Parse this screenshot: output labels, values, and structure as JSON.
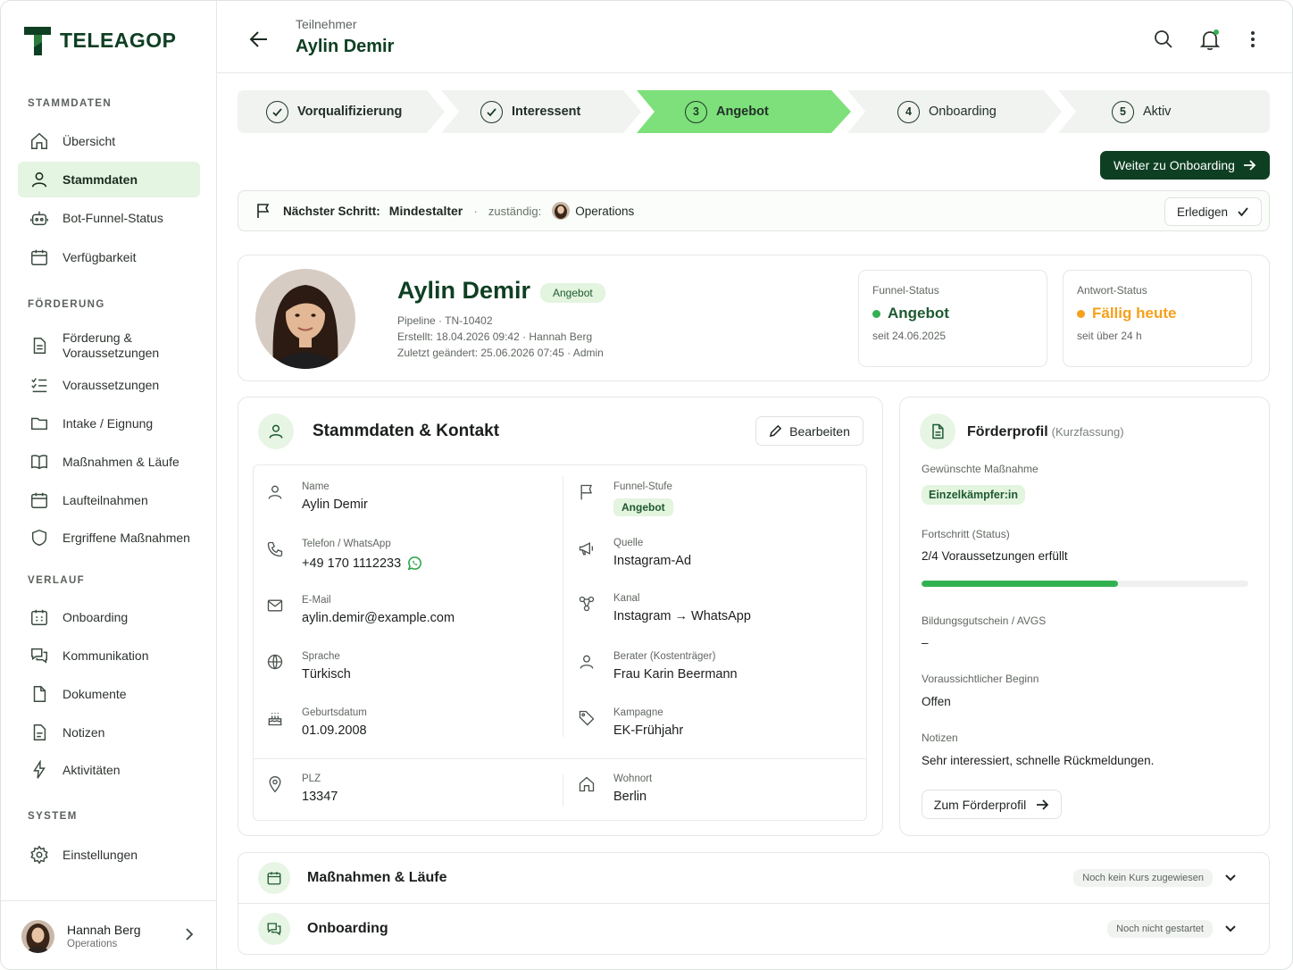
{
  "brand": {
    "name": "TELEAGOP"
  },
  "sidebar": {
    "sections": {
      "stammdaten": "STAMMDATEN",
      "foerderung": "FÖRDERUNG",
      "verlauf": "VERLAUF",
      "system": "SYSTEM"
    },
    "items": {
      "uebersicht": "Übersicht",
      "stammdaten": "Stammdaten",
      "bot_funnel_status": "Bot-Funnel-Status",
      "verfuegbarkeit": "Verfügbarkeit",
      "foerderung_line1": "Förderung &",
      "foerderung_line2": "Voraussetzungen",
      "voraussetzungen": "Voraussetzungen",
      "intake": "Intake / Eignung",
      "massnahmen": "Maßnahmen & Läufe",
      "laufteilnahmen": "Laufteilnahmen",
      "ergriffene": "Ergriffene Maßnahmen",
      "onboarding": "Onboarding",
      "kommunikation": "Kommunikation",
      "dokumente": "Dokumente",
      "notizen": "Notizen",
      "aktivitaeten": "Aktivitäten",
      "einstellungen": "Einstellungen"
    },
    "user": {
      "name": "Hannah Berg",
      "role": "Operations"
    }
  },
  "header": {
    "breadcrumb": "Teilnehmer",
    "title": "Aylin Demir"
  },
  "stepper": {
    "steps": [
      {
        "label": "Vorqualifizierung",
        "marker": "check",
        "state": "done"
      },
      {
        "label": "Interessent",
        "marker": "check",
        "state": "done"
      },
      {
        "label": "Angebot",
        "marker": "3",
        "state": "active"
      },
      {
        "label": "Onboarding",
        "marker": "4",
        "state": "upcoming"
      },
      {
        "label": "Aktiv",
        "marker": "5",
        "state": "upcoming"
      }
    ]
  },
  "actions": {
    "next_button": "Weiter zu Onboarding"
  },
  "next_step": {
    "label": "Nächster Schritt:",
    "value": "Mindestalter",
    "separator": "·",
    "owner_label": "zuständig:",
    "owner": "Operations",
    "done_button": "Erledigen"
  },
  "profile": {
    "name": "Aylin Demir",
    "badge": "Angebot",
    "meta_line1": "Pipeline  ·  TN-10402",
    "meta_line2": "Erstellt:   18.04.2026 09:42  ·  Hannah Berg",
    "meta_line3": "Zuletzt geändert:   25.06.2026 07:45  ·  Admin",
    "funnel_status": {
      "title": "Funnel-Status",
      "value": "Angebot",
      "since": "seit 24.06.2025",
      "color": "#32b151"
    },
    "antwort_status": {
      "title": "Antwort-Status",
      "value": "Fällig heute",
      "since": "seit über 24 h",
      "color": "#f5a01a"
    }
  },
  "contact": {
    "title": "Stammdaten & Kontakt",
    "edit_button": "Bearbeiten",
    "name_label": "Name",
    "name_value": "Aylin Demir",
    "phone_label": "Telefon / WhatsApp",
    "phone_value": "+49 170 1112233",
    "email_label": "E-Mail",
    "email_value": "aylin.demir@example.com",
    "sprache_label": "Sprache",
    "sprache_value": "Türkisch",
    "geburt_label": "Geburtsdatum",
    "geburt_value": "01.09.2008",
    "plz_label": "PLZ",
    "plz_value": "13347",
    "funnel_label": "Funnel-Stufe",
    "funnel_value": "Angebot",
    "quelle_label": "Quelle",
    "quelle_value": "Instagram-Ad",
    "kanal_label": "Kanal",
    "kanal_value": "Instagram  →  WhatsApp",
    "berater_label": "Berater (Kostenträger)",
    "berater_value": "Frau Karin Beermann",
    "kampagne_label": "Kampagne",
    "kampagne_value": "EK-Frühjahr",
    "wohnort_label": "Wohnort",
    "wohnort_value": "Berlin"
  },
  "foerderprofil": {
    "title": "Förderprofil",
    "subtitle": "(Kurzfassung)",
    "massnahme_label": "Gewünschte Maßnahme",
    "massnahme_value": "Einzelkämpfer:in",
    "fortschritt_label": "Fortschritt (Status)",
    "fortschritt_value": "2/4 Voraussetzungen erfüllt",
    "fortschritt_fraction": 0.6,
    "gutschein_label": "Bildungsgutschein / AVGS",
    "gutschein_value": "–",
    "beginn_label": "Voraussichtlicher Beginn",
    "beginn_value": "Offen",
    "notizen_label": "Notizen",
    "notizen_value": "Sehr interessiert, schnelle Rückmeldungen.",
    "button": "Zum Förderprofil"
  },
  "accordion": {
    "massnahmen": {
      "title": "Maßnahmen & Läufe",
      "status": "Noch kein Kurs zugewiesen"
    },
    "onboarding": {
      "title": "Onboarding",
      "status": "Noch nicht gestartet"
    }
  },
  "colors": {
    "brand": "#0e3f22",
    "accent_green": "#7ee07a",
    "light_green": "#e4f5e1",
    "warning": "#f5a01a"
  }
}
